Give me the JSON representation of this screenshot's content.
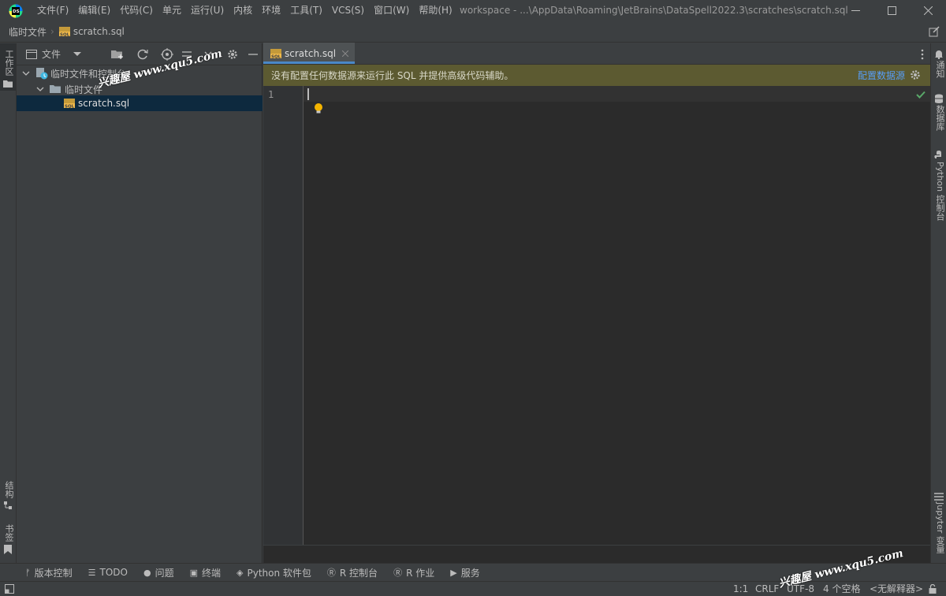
{
  "app": {
    "logo_text": "DS",
    "window_title": "workspace - ...\\AppData\\Roaming\\JetBrains\\DataSpell2022.3\\scratches\\scratch.sql"
  },
  "menu": [
    "文件(F)",
    "编辑(E)",
    "代码(C)",
    "单元",
    "运行(U)",
    "内核",
    "环境",
    "工具(T)",
    "VCS(S)",
    "窗口(W)",
    "帮助(H)"
  ],
  "breadcrumb": {
    "root": "临时文件",
    "file": "scratch.sql"
  },
  "left_strip": {
    "top": "工作区",
    "structure": "结构",
    "bookmarks": "书签"
  },
  "project_panel": {
    "view_selector": "文件",
    "tree": [
      {
        "label": "临时文件和控制台",
        "depth": 0,
        "expanded": true,
        "icon": "scratches-icon"
      },
      {
        "label": "临时文件",
        "depth": 1,
        "expanded": true,
        "icon": "folder-icon"
      },
      {
        "label": "scratch.sql",
        "depth": 2,
        "selected": true,
        "icon": "sql-file-icon"
      }
    ]
  },
  "editor": {
    "tab_label": "scratch.sql",
    "banner_text": "没有配置任何数据源来运行此 SQL 并提供高级代码辅助。",
    "banner_link": "配置数据源",
    "line_numbers": [
      "1"
    ]
  },
  "right_strip": {
    "notifications": "通知",
    "database": "数据库",
    "python_console": "Python 控制台",
    "jupyter_vars": "Jupyter 变量"
  },
  "bottom_tools": [
    {
      "icon": "vcs-icon",
      "glyph": "ᚠ",
      "label": "版本控制"
    },
    {
      "icon": "todo-icon",
      "glyph": "☰",
      "label": "TODO"
    },
    {
      "icon": "problems-icon",
      "glyph": "●",
      "label": "问题"
    },
    {
      "icon": "terminal-icon",
      "glyph": "▣",
      "label": "终端"
    },
    {
      "icon": "python-packages-icon",
      "glyph": "◈",
      "label": "Python 软件包"
    },
    {
      "icon": "r-console-icon",
      "glyph": "Ⓡ",
      "label": "R 控制台"
    },
    {
      "icon": "r-jobs-icon",
      "glyph": "Ⓡ",
      "label": "R 作业"
    },
    {
      "icon": "services-icon",
      "glyph": "▶",
      "label": "服务"
    }
  ],
  "status": {
    "position": "1:1",
    "line_separator": "CRLF",
    "encoding": "UTF-8",
    "indent": "4 个空格",
    "interpreter": "<无解释器>"
  },
  "watermark": {
    "text": "兴趣屋 www.xqu5.com"
  },
  "colors": {
    "accent": "#4a88c7",
    "banner_bg": "#5c5a31",
    "link": "#589df6",
    "selection": "#0d293e"
  }
}
